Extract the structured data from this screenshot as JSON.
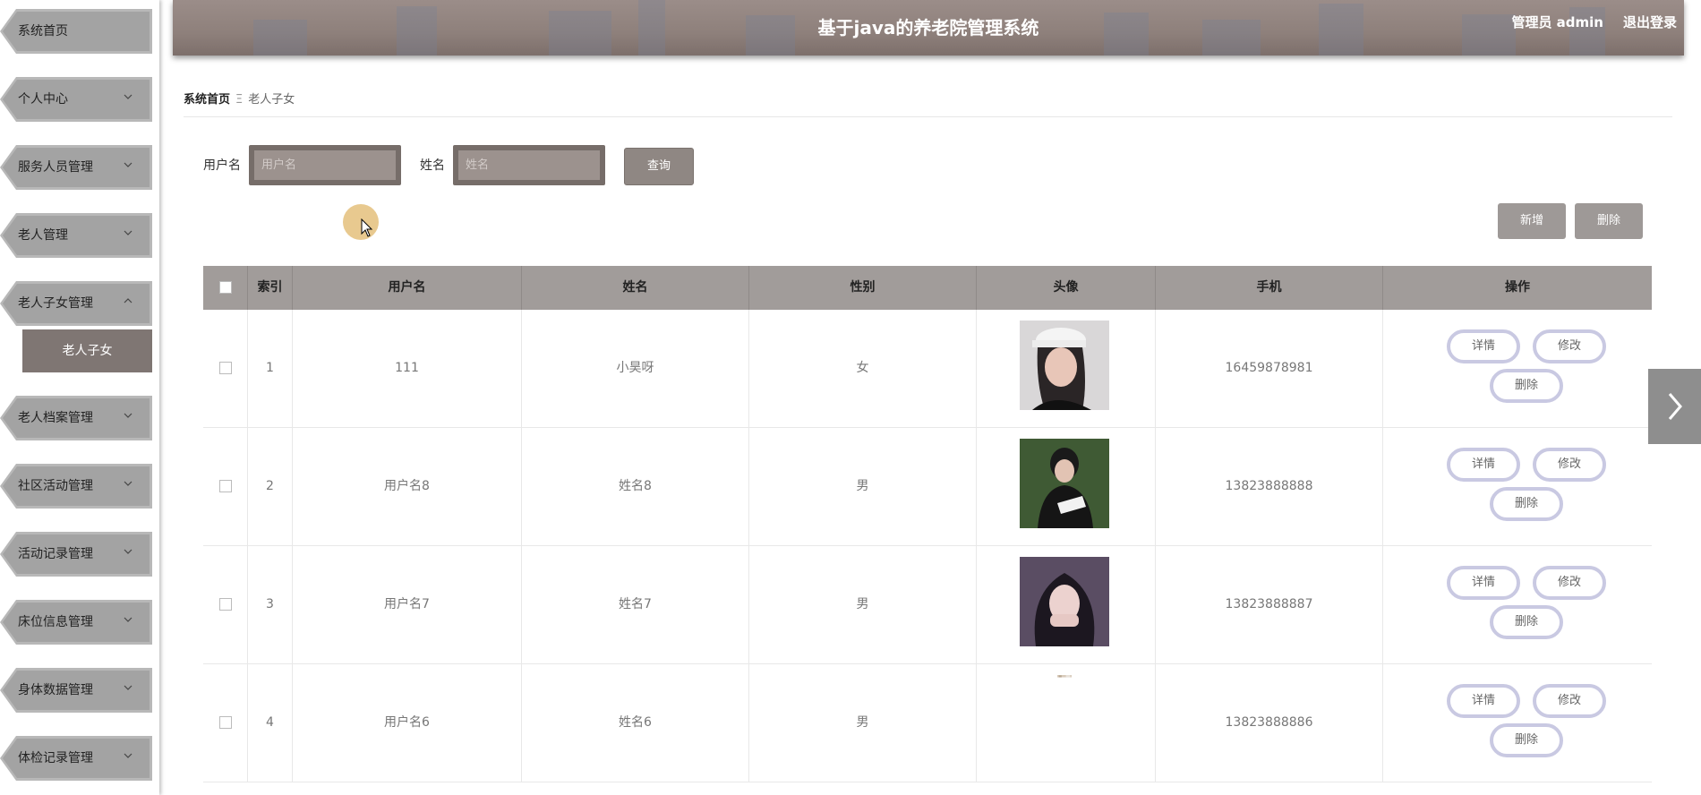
{
  "header": {
    "title": "基于java的养老院管理系统",
    "user": "管理员 admin",
    "logout": "退出登录"
  },
  "sidebar": {
    "items": [
      {
        "label": "系统首页"
      },
      {
        "label": "个人中心"
      },
      {
        "label": "服务人员管理"
      },
      {
        "label": "老人管理"
      },
      {
        "label": "老人子女管理"
      },
      {
        "label": "老人档案管理"
      },
      {
        "label": "社区活动管理"
      },
      {
        "label": "活动记录管理"
      },
      {
        "label": "床位信息管理"
      },
      {
        "label": "身体数据管理"
      },
      {
        "label": "体检记录管理"
      }
    ],
    "active_sub": "老人子女"
  },
  "breadcrumb": {
    "home": "系统首页",
    "sep": "Ξ",
    "current": "老人子女"
  },
  "search": {
    "username_label": "用户名",
    "username_placeholder": "用户名",
    "name_label": "姓名",
    "name_placeholder": "姓名",
    "query_label": "查询"
  },
  "toolbar": {
    "add_label": "新增",
    "delete_label": "删除"
  },
  "table": {
    "headers": [
      "索引",
      "用户名",
      "姓名",
      "性别",
      "头像",
      "手机",
      "操作"
    ],
    "rows": [
      {
        "index": "1",
        "username": "111",
        "name": "小昊呀",
        "gender": "女",
        "phone": "16459878981"
      },
      {
        "index": "2",
        "username": "用户名8",
        "name": "姓名8",
        "gender": "男",
        "phone": "13823888888"
      },
      {
        "index": "3",
        "username": "用户名7",
        "name": "姓名7",
        "gender": "男",
        "phone": "13823888887"
      },
      {
        "index": "4",
        "username": "用户名6",
        "name": "姓名6",
        "gender": "男",
        "phone": "13823888886"
      }
    ],
    "actions": {
      "detail": "详情",
      "edit": "修改",
      "delete": "删除"
    }
  },
  "colors": {
    "header_bg": "#8e807b",
    "sidebar_item": "#a3a3a3",
    "submenu_active": "#7f7673",
    "table_head": "#a19c9a",
    "action_border": "#c9c9e2"
  }
}
